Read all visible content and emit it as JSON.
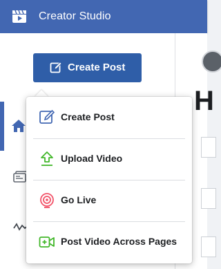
{
  "header": {
    "title": "Creator Studio"
  },
  "sidebar": {
    "create_button_label": "Create Post"
  },
  "content": {
    "heading_peek": "H"
  },
  "menu": {
    "items": [
      {
        "label": "Create Post",
        "icon": "edit-icon",
        "color": "#4267b2"
      },
      {
        "label": "Upload Video",
        "icon": "upload-icon",
        "color": "#42b72a"
      },
      {
        "label": "Go Live",
        "icon": "live-icon",
        "color": "#f25268"
      },
      {
        "label": "Post Video Across Pages",
        "icon": "video-pages-icon",
        "color": "#42b72a"
      }
    ]
  },
  "colors": {
    "header": "#4267b2",
    "button": "#2f5ea8"
  }
}
